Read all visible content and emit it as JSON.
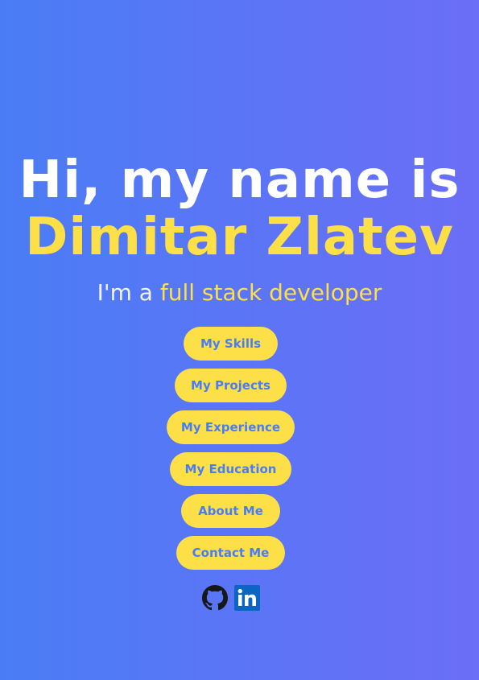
{
  "hero": {
    "greeting": "Hi, my name is",
    "name": "Dimitar Zlatev",
    "tagline_prefix": "I'm a ",
    "tagline_role": "full stack developer"
  },
  "nav": [
    {
      "label": "My Skills"
    },
    {
      "label": "My Projects"
    },
    {
      "label": "My Experience"
    },
    {
      "label": "My Education"
    },
    {
      "label": "About Me"
    },
    {
      "label": "Contact Me"
    }
  ],
  "social": [
    {
      "icon": "github-icon"
    },
    {
      "icon": "linkedin-icon"
    }
  ],
  "colors": {
    "background_start": "#4a7df5",
    "background_end": "#6b6ef7",
    "accent": "#fde047",
    "heading": "#ffffff",
    "button_text": "#4a7df5",
    "linkedin": "#0a66c2",
    "github": "#181717"
  }
}
